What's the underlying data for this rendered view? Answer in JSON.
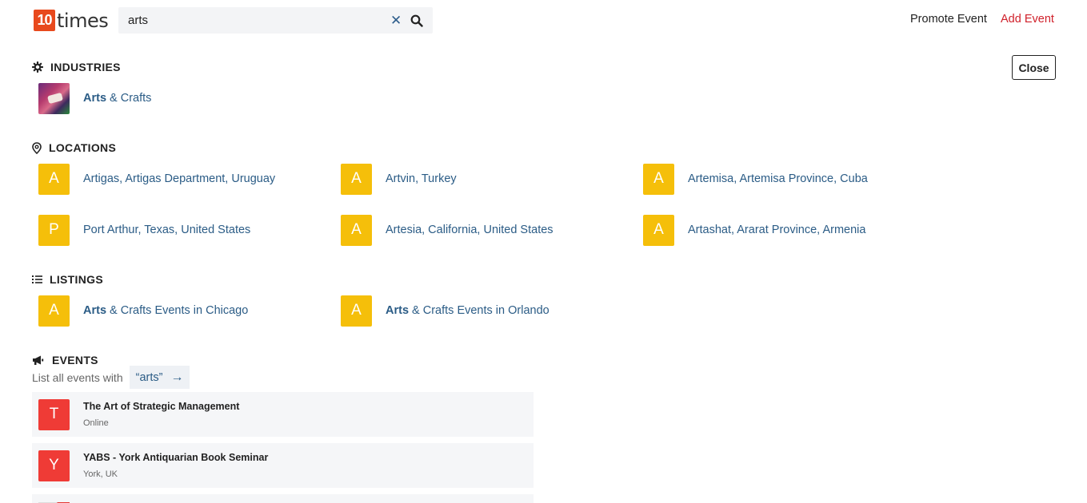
{
  "header": {
    "logo_number": "10",
    "logo_text": "times",
    "search_value": "arts",
    "promote_label": "Promote Event",
    "add_label": "Add Event",
    "close_label": "Close"
  },
  "industries": {
    "title": "INDUSTRIES",
    "items": [
      {
        "bold": "Arts",
        "rest": " & Crafts"
      }
    ]
  },
  "locations": {
    "title": "LOCATIONS",
    "items": [
      {
        "letter": "A",
        "label": "Artigas, Artigas Department, Uruguay"
      },
      {
        "letter": "A",
        "label": "Artvin, Turkey"
      },
      {
        "letter": "A",
        "label": "Artemisa, Artemisa Province, Cuba"
      },
      {
        "letter": "P",
        "label": "Port Arthur, Texas, United States"
      },
      {
        "letter": "A",
        "label": "Artesia, California, United States"
      },
      {
        "letter": "A",
        "label": "Artashat, Ararat Province, Armenia"
      }
    ]
  },
  "listings": {
    "title": "LISTINGS",
    "items": [
      {
        "letter": "A",
        "bold": "Arts",
        "rest": " & Crafts Events in Chicago"
      },
      {
        "letter": "A",
        "bold": "Arts",
        "rest": " & Crafts Events in Orlando"
      }
    ]
  },
  "events": {
    "title": "EVENTS",
    "list_all_text": "List all events with",
    "query_chip": "“arts”",
    "arrow": "→",
    "items": [
      {
        "letter": "T",
        "title": "The Art of Strategic Management",
        "subtitle": "Online"
      },
      {
        "letter": "Y",
        "title": "YABS - York Antiquarian Book Seminar",
        "subtitle": "York, UK"
      }
    ]
  },
  "colors": {
    "brand": "#e8491d",
    "link": "#2b5c86",
    "add_event": "#d0202a",
    "avatar_yellow": "#f5bf0a",
    "avatar_red": "#ef3b36"
  },
  "icons": {
    "industries": "gear-icon",
    "locations": "map-pin-icon",
    "listings": "list-icon",
    "events": "megaphone-icon",
    "clear": "close-icon",
    "search": "search-icon"
  }
}
